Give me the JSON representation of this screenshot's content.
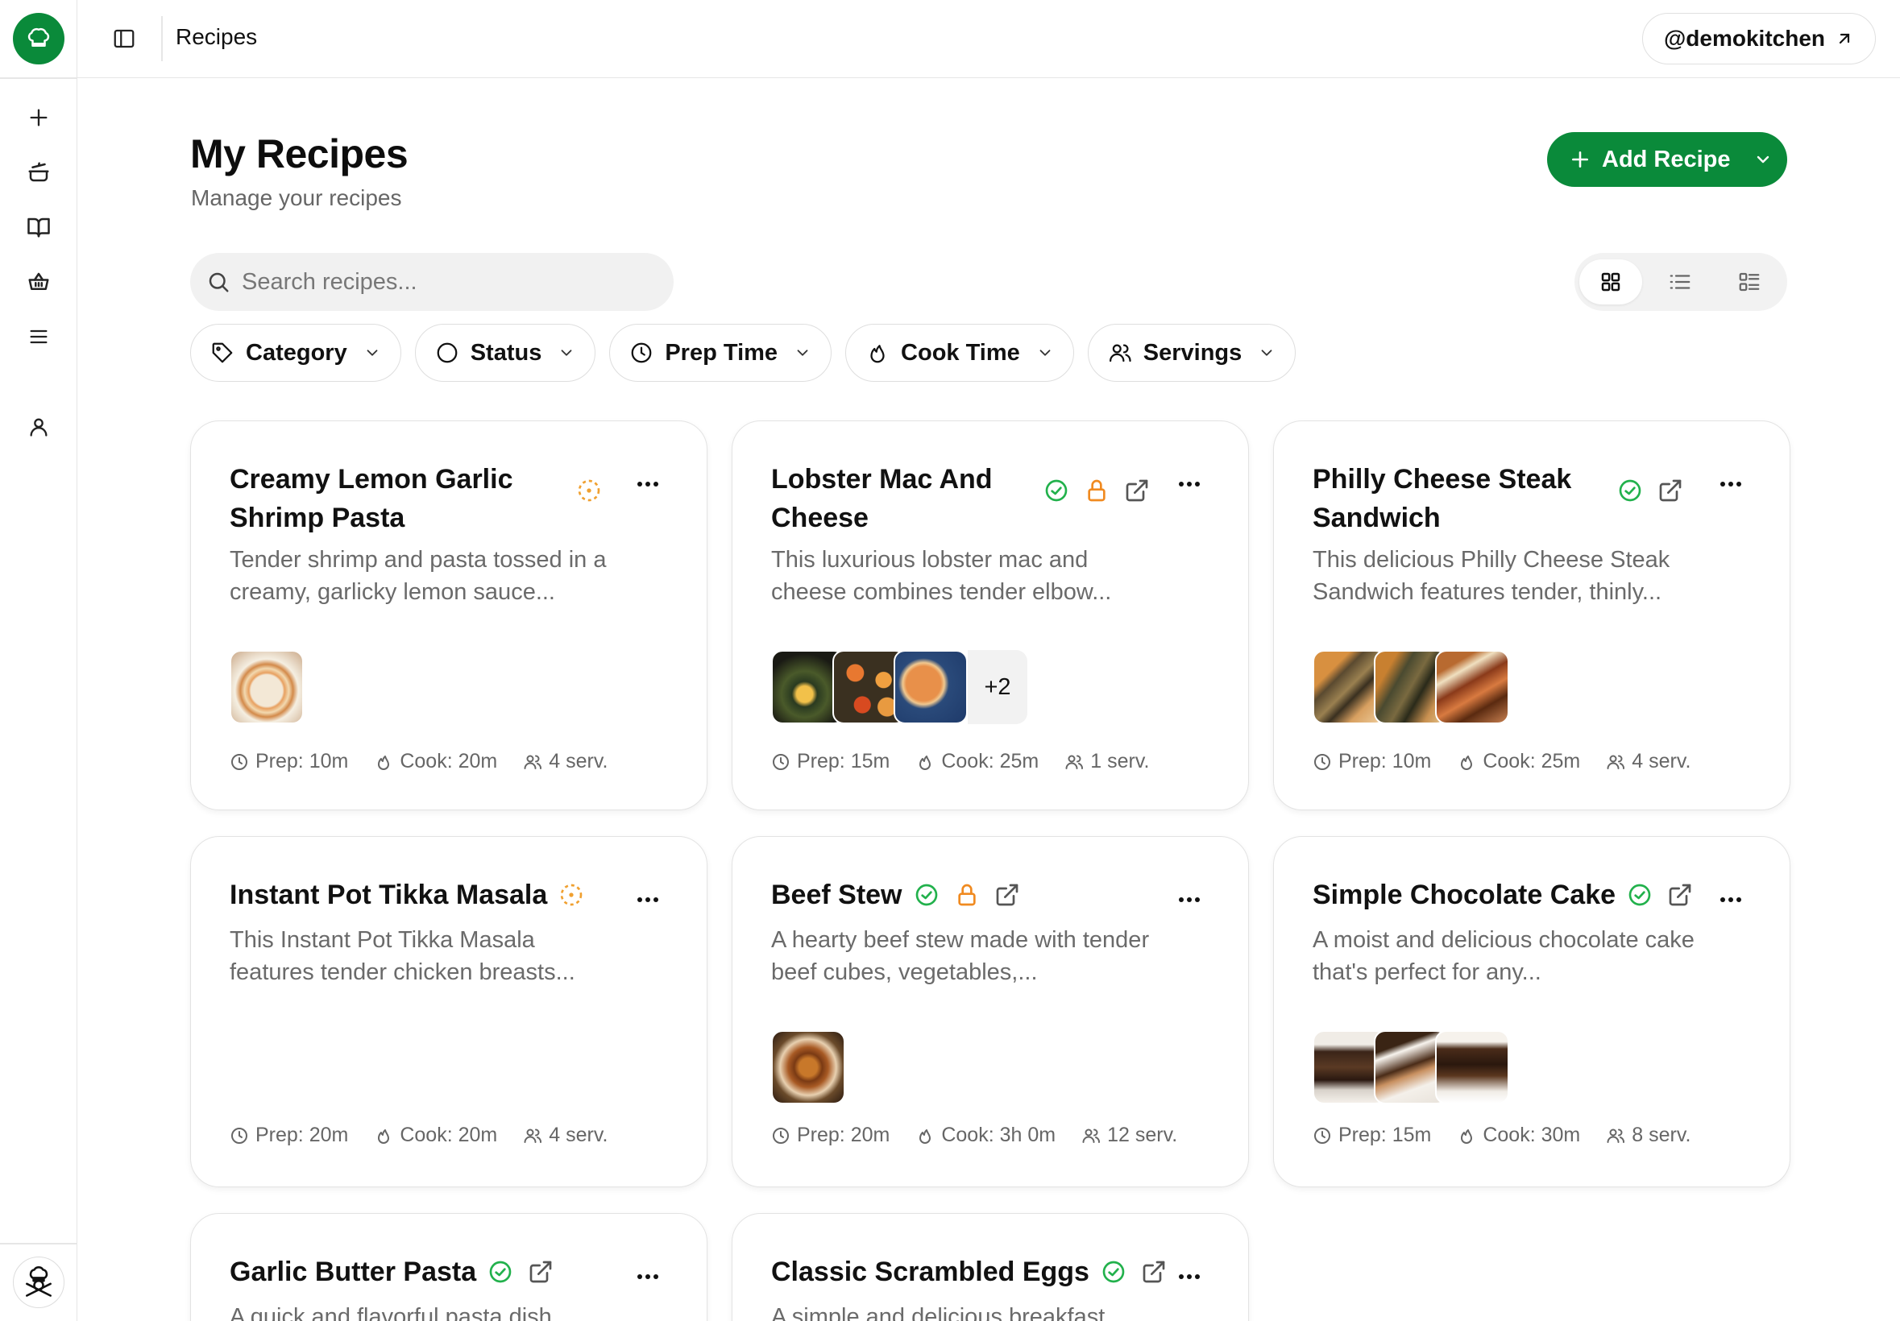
{
  "app": {
    "page_heading": "Recipes",
    "user_handle": "@demokitchen"
  },
  "header": {
    "title": "My Recipes",
    "subtitle": "Manage your recipes",
    "add_button": "Add Recipe"
  },
  "search": {
    "placeholder": "Search recipes..."
  },
  "filters": [
    {
      "label": "Category",
      "icon": "tag-icon"
    },
    {
      "label": "Status",
      "icon": "circle-icon"
    },
    {
      "label": "Prep Time",
      "icon": "clock-icon"
    },
    {
      "label": "Cook Time",
      "icon": "flame-icon"
    },
    {
      "label": "Servings",
      "icon": "users-icon"
    }
  ],
  "view_modes": [
    "grid",
    "list",
    "compact-list"
  ],
  "active_view": "grid",
  "sidebar": {
    "items": [
      "add-icon",
      "cooking-pot-icon",
      "book-icon",
      "basket-icon",
      "menu-icon",
      "user-icon"
    ]
  },
  "colors": {
    "brand": "#0a8a3a",
    "draft": "#f0a030",
    "locked": "#f08a20",
    "published": "#22b14c"
  },
  "recipes": [
    {
      "title": "Creamy Lemon Garlic Shrimp Pasta",
      "status": "draft",
      "locked": false,
      "shared": false,
      "description": "Tender shrimp and pasta tossed in a creamy, garlicky lemon sauce...",
      "photo_count": 1,
      "extra_photos": "",
      "prep": "Prep: 10m",
      "cook": "Cook: 20m",
      "servings": "4 serv."
    },
    {
      "title": "Lobster Mac And Cheese",
      "status": "published",
      "locked": true,
      "shared": true,
      "description": "This luxurious lobster mac and cheese combines tender elbow...",
      "photo_count": 3,
      "extra_photos": "+2",
      "prep": "Prep: 15m",
      "cook": "Cook: 25m",
      "servings": "1 serv."
    },
    {
      "title": "Philly Cheese Steak Sandwich",
      "status": "published",
      "locked": false,
      "shared": true,
      "description": "This delicious Philly Cheese Steak Sandwich features tender, thinly...",
      "photo_count": 3,
      "extra_photos": "",
      "prep": "Prep: 10m",
      "cook": "Cook: 25m",
      "servings": "4 serv."
    },
    {
      "title": "Instant Pot Tikka Masala",
      "status": "draft",
      "locked": false,
      "shared": false,
      "description": "This Instant Pot Tikka Masala features tender chicken breasts...",
      "photo_count": 0,
      "extra_photos": "",
      "prep": "Prep: 20m",
      "cook": "Cook: 20m",
      "servings": "4 serv."
    },
    {
      "title": "Beef Stew",
      "status": "published",
      "locked": true,
      "shared": true,
      "description": "A hearty beef stew made with tender beef cubes, vegetables,...",
      "photo_count": 1,
      "extra_photos": "",
      "prep": "Prep: 20m",
      "cook": "Cook: 3h 0m",
      "servings": "12 serv."
    },
    {
      "title": "Simple Chocolate Cake",
      "status": "published",
      "locked": false,
      "shared": true,
      "description": "A moist and delicious chocolate cake that's perfect for any...",
      "photo_count": 3,
      "extra_photos": "",
      "prep": "Prep: 15m",
      "cook": "Cook: 30m",
      "servings": "8 serv."
    },
    {
      "title": "Garlic Butter Pasta",
      "status": "published",
      "locked": false,
      "shared": true,
      "description": "A quick and flavorful pasta dish...",
      "photo_count": 0,
      "extra_photos": "",
      "prep": "",
      "cook": "",
      "servings": ""
    },
    {
      "title": "Classic Scrambled Eggs",
      "status": "published",
      "locked": false,
      "shared": true,
      "description": "A simple and delicious breakfast...",
      "photo_count": 0,
      "extra_photos": "",
      "prep": "",
      "cook": "",
      "servings": ""
    }
  ]
}
